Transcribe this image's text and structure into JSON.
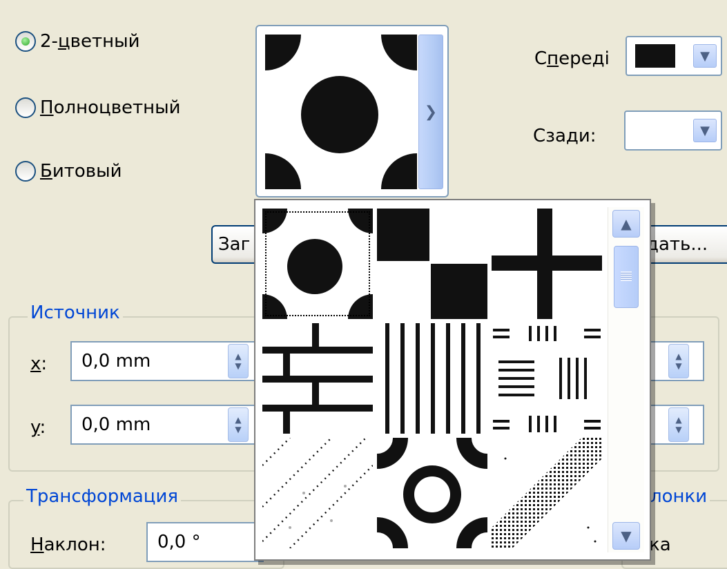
{
  "fill_type": {
    "options": [
      {
        "pre": "2-",
        "u": "ц",
        "post": "ветный",
        "selected": true
      },
      {
        "pre": "",
        "u": "П",
        "post": "олноцветный",
        "selected": false
      },
      {
        "pre": "",
        "u": "Б",
        "post": "итовый",
        "selected": false
      }
    ]
  },
  "colors": {
    "front": {
      "pre": "С",
      "u": "п",
      "post": "ереді",
      "swatch": "#111111"
    },
    "back": {
      "pre": "Сза",
      "u": "д",
      "post": "и:",
      "swatch": "#ffffff"
    }
  },
  "buttons": {
    "load_partial": "Заг",
    "create_partial": "дать..."
  },
  "source": {
    "title": "Источник",
    "x": {
      "label_u": "x",
      "label_rest": ":",
      "value": "0,0 mm"
    },
    "y": {
      "label_u": "y",
      "label_rest": ":",
      "value": "0,0 mm"
    }
  },
  "transform": {
    "title": "Трансформация",
    "skew": {
      "label_u": "Н",
      "label_rest": "аклон:",
      "value": "0,0 °"
    }
  },
  "partial_right": {
    "group": "лонки",
    "checkbox": "ка"
  },
  "icons": {
    "up": "▲",
    "down": "▼"
  },
  "pattern_selected_index": 0
}
